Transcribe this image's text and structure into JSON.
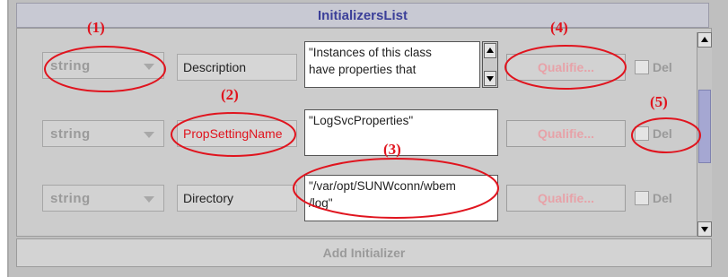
{
  "window": {
    "title": "InitializersList"
  },
  "rows": [
    {
      "type": "string",
      "name": "Description",
      "value_lines": [
        "\"Instances of this class",
        "have properties  that"
      ],
      "qualifier_label": "Qualifie...",
      "del_label": "Del"
    },
    {
      "type": "string",
      "name": "PropSettingName",
      "value_lines": [
        "\"LogSvcProperties\""
      ],
      "qualifier_label": "Qualifie...",
      "del_label": "Del"
    },
    {
      "type": "string",
      "name": "Directory",
      "value_lines": [
        "\"/var/opt/SUNWconn/wbem",
        "/log\""
      ],
      "qualifier_label": "Qualifie...",
      "del_label": "Del"
    }
  ],
  "add_button": {
    "label": "Add Initializer"
  },
  "annotations": [
    "(1)",
    "(2)",
    "(3)",
    "(4)",
    "(5)"
  ],
  "colors": {
    "annotation": "#e0141e",
    "title_text": "#3b3f99",
    "disabled_text": "#9a9a9a",
    "qualifier_text": "#e7a2a8"
  },
  "icons": {
    "type_dropdown": "chevron-down-icon",
    "scroll_up": "arrow-up-icon",
    "scroll_down": "arrow-down-icon"
  }
}
